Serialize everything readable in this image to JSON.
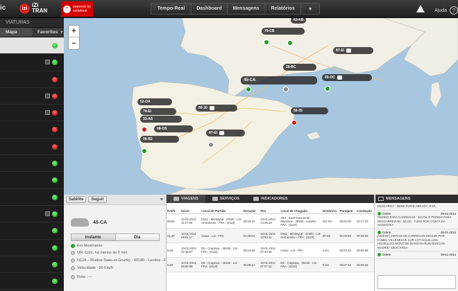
{
  "topbar": {
    "logo_left": "ic",
    "izi_badge": "izi",
    "izi_text": "iZi\nTRAN",
    "vodafone_text": "powered by\nvodafone",
    "nav": [
      {
        "label": "Tempo-Real",
        "w": 58
      },
      {
        "label": "Dashboard",
        "w": 52
      },
      {
        "label": "Mensagens",
        "w": 54
      },
      {
        "label": "Relatórios",
        "w": 52
      },
      {
        "label": "▾",
        "w": 26
      }
    ],
    "help_label": "Ajuda",
    "help_icon": "?"
  },
  "sidebar": {
    "title": "VIATURAS",
    "tab_map": "Mapa",
    "tab_favorites": "Favoritos",
    "rows": [
      {
        "status": "green",
        "selected": true,
        "square": false
      },
      {
        "status": "green",
        "selected": false,
        "square": true
      },
      {
        "status": "red",
        "selected": false,
        "square": false
      },
      {
        "status": "red",
        "selected": false,
        "square": true
      },
      {
        "status": "red",
        "selected": false,
        "square": true
      },
      {
        "status": "red",
        "selected": false,
        "square": false
      },
      {
        "status": "red",
        "selected": false,
        "square": false
      },
      {
        "status": "green",
        "selected": false,
        "square": false
      },
      {
        "status": "green",
        "selected": false,
        "square": false
      },
      {
        "status": "green",
        "selected": false,
        "square": false
      },
      {
        "status": "green",
        "selected": false,
        "square": true
      },
      {
        "status": "green",
        "selected": false,
        "square": false
      },
      {
        "status": "green",
        "selected": false,
        "square": false
      },
      {
        "status": "green",
        "selected": false,
        "square": false
      },
      {
        "status": "green",
        "selected": false,
        "square": false
      }
    ]
  },
  "map": {
    "zoom_in": "+",
    "zoom_out": "−",
    "labels": [
      {
        "text": "63-KB",
        "cls": "t1"
      },
      {
        "text": "79-CB",
        "cls": "t2"
      },
      {
        "text": "87-EI",
        "cls": "t3"
      },
      {
        "text": "28-BC",
        "cls": "t4"
      },
      {
        "text": "45-CA",
        "cls": "t5"
      },
      {
        "text": "09-OC",
        "cls": "t6"
      },
      {
        "text": "52-OA",
        "cls": "t7"
      },
      {
        "text": "74-EI",
        "cls": "t8"
      },
      {
        "text": "33-AS",
        "cls": "t9"
      },
      {
        "text": "80-30",
        "cls": "t10"
      },
      {
        "text": "59-35",
        "cls": "t11"
      },
      {
        "text": "48-OS",
        "cls": "t12"
      },
      {
        "text": "87-EI",
        "cls": "t13"
      },
      {
        "text": "06-B2",
        "cls": "t14"
      }
    ]
  },
  "vehicle_panel": {
    "btn_satellite": "Satélite",
    "btn_follow": "Seguir",
    "vehicle_name": "45-CA",
    "toggle_instant": "Instante",
    "toggle_day": "Dia",
    "lines": [
      {
        "text": "Em Movimento",
        "dot": "g"
      },
      {
        "text": "UR: Com. há menos de 6 min",
        "dot": "o"
      },
      {
        "text": "N124 – Rivière-Saas-et-Gourby - 40180 - Landes - FRA - [4110]",
        "dot": "o"
      },
      {
        "text": "Velocidade : 90 Km/h",
        "dot": "o"
      },
      {
        "text": "Rota: ----",
        "dot": "o"
      }
    ]
  },
  "trips": {
    "tabs": [
      {
        "label": "VIAGENS",
        "active": true
      },
      {
        "label": "SERVIÇOS",
        "active": false
      },
      {
        "label": "INDICADORES",
        "active": false
      }
    ],
    "columns": [
      "Km/h",
      "Início",
      "Local de Partida",
      "Duração",
      "Fim",
      "Local de Chegada",
      "Distância",
      "Paragem",
      "Condução"
    ],
    "rows": [
      [
        "69,94",
        "10-01-2014 11:17:09",
        "D911 - Montayral - 47500 - Lot-et-Garonne - FRA - [4110]",
        "03:18:10",
        "10-01-2014 14:35:19",
        "A63 - Saint-Geours-de-Maremne - 40230 - Landes - FRA - [4110]",
        "231 km",
        "00:01:00",
        "03:17:10"
      ],
      [
        "21,49",
        "10-01-2014 09:01:17",
        "Catus - Lot - FRA",
        "01:48:54",
        "10-01-2014 10:50:11",
        "D911 - Montayral - 47500 - Lot-et-Garonne - FRA - [4110]",
        "39 km",
        "01:02:59",
        "00:45:55"
      ],
      [
        "8,60",
        "10-01-2014 07:29:57",
        "D6 - Crayssac - 46150 - Lot - FRA - [4110]",
        "00:13:49",
        "10-01-2014 07:43:46",
        "Catus - Lot - FRA",
        "2 km",
        "00:07:40",
        "00:06:09"
      ],
      [
        "0,00",
        "10-01-2014 06:59:08",
        "D6 - Crayssac - 46150 - Lot - FRA - [4110]",
        "00:08:14",
        "10-01-2014 07:07:22",
        "D6 - Crayssac - 46150 - Lot - FRA - [4110]",
        "0 km",
        "00:07:42",
        "00:00:32"
      ]
    ]
  },
  "messages": {
    "title": "MENSAGENS",
    "items": [
      {
        "from": "",
        "date": "",
        "text": "DESCARGA : 28000 FUENLABRADA -ESP..."
      },
      {
        "from": "Odete",
        "date": "09-01-2014",
        "text": "PEDIDO PARA CARREGAR : 32179L E PEDIDO PARA DESCARREGAR : 84120 . TUDO POR CONTA DA SAGENTEA"
      },
      {
        "from": "Odete",
        "date": "09-01-2014",
        "text": "[ODETE:] DEPOIS DE CARREGAR SEGUIR POR FUMEL-VILLENEUVE SUR LOT-AIGUILLON-HOUEILLES-MONT DE MARSAN-IRUN-BURGOS-MADRID- DESCARGA"
      },
      {
        "from": "Odete",
        "date": "09-01-2014",
        "text": ""
      }
    ]
  },
  "colors": {
    "accent_red": "#d50000",
    "status_green": "#1ea01e",
    "status_red": "#d21a1a"
  }
}
